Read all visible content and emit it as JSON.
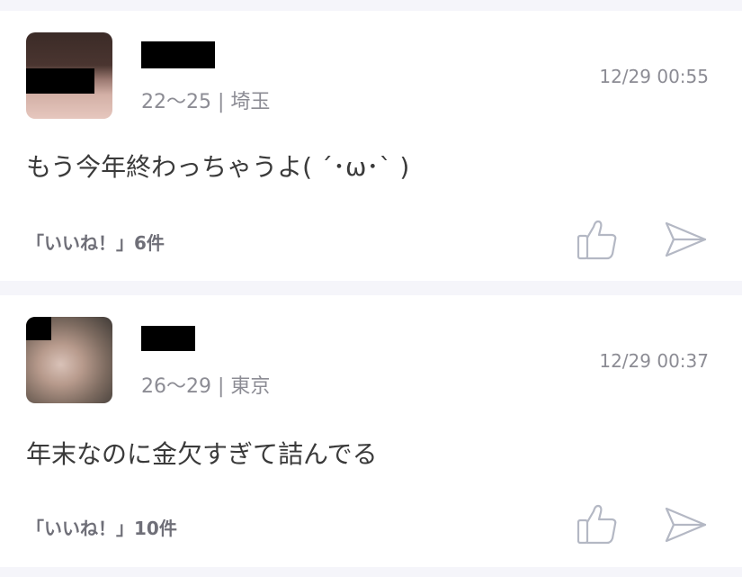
{
  "posts": [
    {
      "meta": "22〜25 | 埼玉",
      "timestamp": "12/29 00:55",
      "body": "もう今年終わっちゃうよ( ´･ω･` )",
      "likes": "「いいね！」6件",
      "like_icon": "thumbs-up-icon",
      "share_icon": "send-icon"
    },
    {
      "meta": "26〜29 | 東京",
      "timestamp": "12/29 00:37",
      "body": "年末なのに金欠すぎて詰んでる",
      "likes": "「いいね！」10件",
      "like_icon": "thumbs-up-icon",
      "share_icon": "send-icon"
    }
  ],
  "colors": {
    "background": "#f5f5fa",
    "card": "#ffffff",
    "meta_text": "#8c8c94",
    "body_text": "#3a3a3a",
    "likes_text": "#6f6f78",
    "icon_stroke": "#b4b8c4"
  }
}
